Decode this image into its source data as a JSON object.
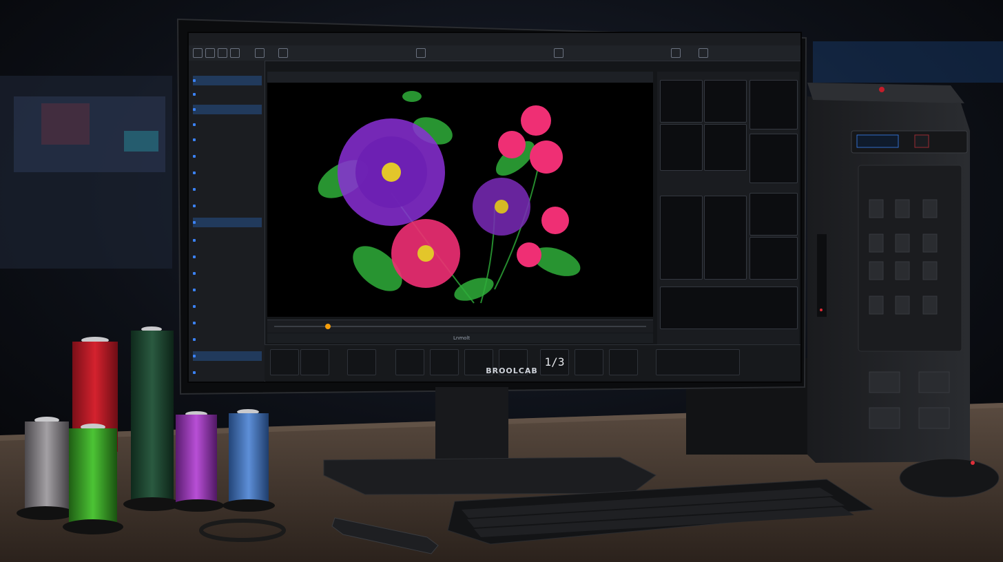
{
  "monitor": {
    "brand": "BROOLCAB",
    "bottom_readout": "1/3",
    "timeline_label": "Lnmolt"
  },
  "colors": {
    "thread_red": "#c41d2a",
    "thread_dark_green": "#1f4a33",
    "thread_green": "#39a52a",
    "thread_gray": "#8d8a8e",
    "thread_purple": "#a23fc3",
    "thread_blue": "#4d7bc4",
    "flower_purple": "#8a2fd6",
    "flower_pink": "#ef2f74",
    "leaf_green": "#2fae3a",
    "ui_accent": "#3b82f6"
  },
  "icons": [
    "monitor-icon",
    "pc-tower-icon",
    "keyboard-icon",
    "mouse-icon",
    "thread-spool-icon",
    "stylus-icon"
  ]
}
